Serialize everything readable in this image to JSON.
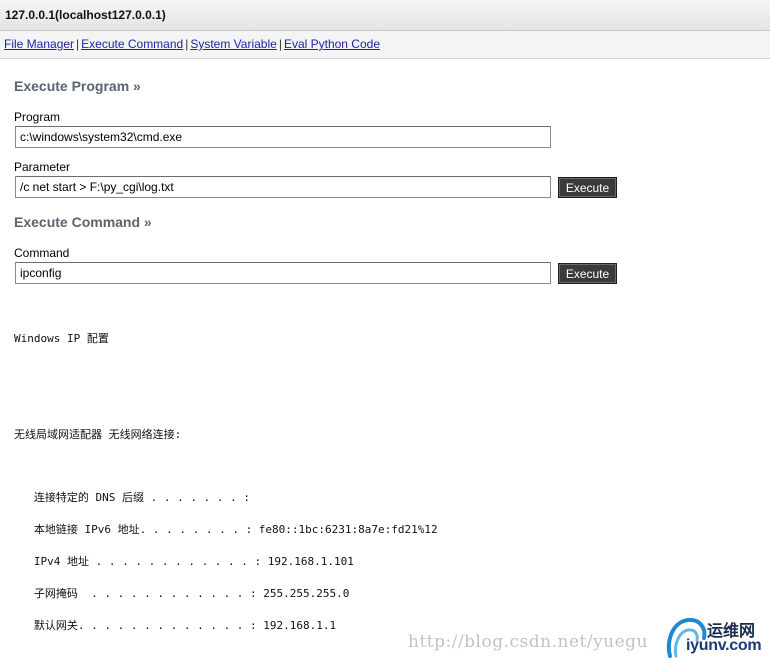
{
  "window": {
    "title": "127.0.0.1(localhost127.0.0.1)"
  },
  "nav": {
    "links": [
      "File Manager",
      "Execute Command",
      "System Variable",
      "Eval Python Code"
    ],
    "separator": "|"
  },
  "execute_program": {
    "heading": "Execute Program »",
    "program_label": "Program",
    "program_value": "c:\\windows\\system32\\cmd.exe",
    "parameter_label": "Parameter",
    "parameter_value": "/c net start > F:\\py_cgi\\log.txt",
    "button_label": "Execute"
  },
  "execute_command": {
    "heading": "Execute Command »",
    "command_label": "Command",
    "command_value": "ipconfig",
    "button_label": "Execute"
  },
  "output": {
    "lines": [
      "Windows IP 配置",
      "无线局域网适配器 无线网络连接:",
      "   连接特定的 DNS 后缀 . . . . . . . :",
      "   本地链接 IPv6 地址. . . . . . . . : fe80::1bc:6231:8a7e:fd21%12",
      "   IPv4 地址 . . . . . . . . . . . . : 192.168.1.101",
      "   子网掩码  . . . . . . . . . . . . : 255.255.255.0",
      "   默认网关. . . . . . . . . . . . . : 192.168.1.1"
    ]
  },
  "watermark": {
    "url": "http://blog.csdn.net/yuegu",
    "logo_top": "运维网",
    "logo_bottom": "iyunv.com",
    "logo_accent": "#1e88d0"
  }
}
